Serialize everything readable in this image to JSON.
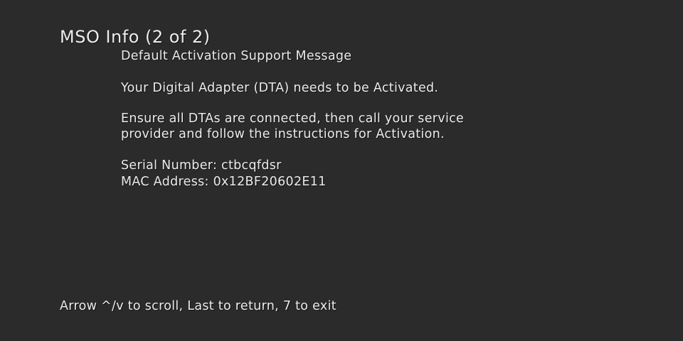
{
  "screen": {
    "title": "MSO Info (2 of 2)",
    "subtitle": "Default Activation Support Message",
    "activation_notice": "Your Digital Adapter (DTA) needs to be Activated.",
    "instructions_line1": "Ensure all DTAs are connected, then call your service",
    "instructions_line2": "provider and follow the instructions for Activation.",
    "serial_number": "Serial Number: ctbcqfdsr",
    "mac_address": "MAC Address: 0x12BF20602E11",
    "footer_hint": "Arrow ^/v to scroll, Last to return, 7 to exit"
  }
}
